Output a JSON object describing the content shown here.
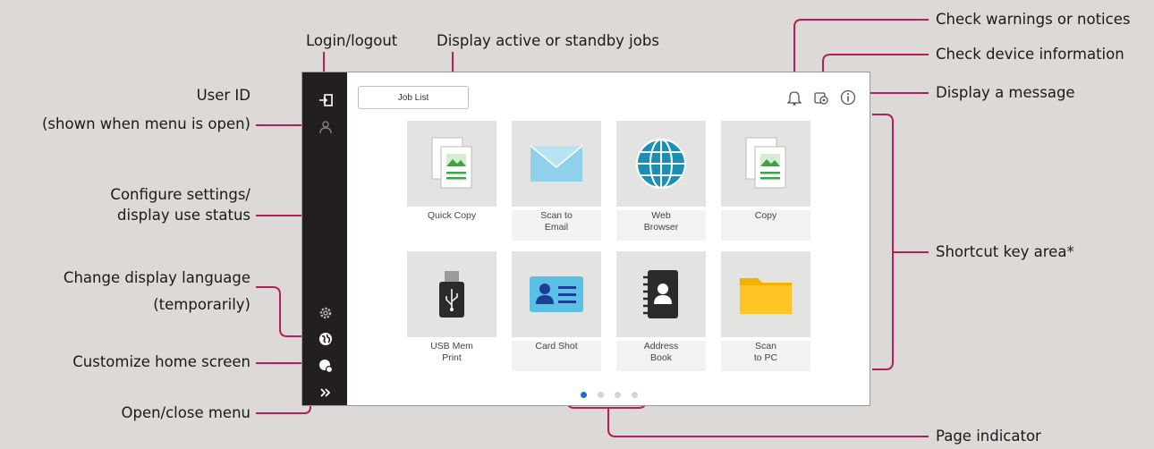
{
  "callouts": {
    "login_logout": "Login/logout",
    "active_jobs": "Display active or standby jobs",
    "user_id_1": "User ID",
    "user_id_2": "(shown when menu is open)",
    "configure_1": "Configure settings/",
    "configure_2": "display use status",
    "language_1": "Change display language",
    "language_2": "(temporarily)",
    "customize": "Customize home screen",
    "open_close": "Open/close menu",
    "warnings": "Check warnings or notices",
    "device_info": "Check device information",
    "message": "Display a message",
    "shortcut_area": "Shortcut key area*",
    "page_indicator": "Page indicator"
  },
  "screen": {
    "job_list_label": "Job List",
    "tiles": [
      {
        "line1": "Quick Copy",
        "line2": "",
        "icon": "copy-icon"
      },
      {
        "line1": "Scan to",
        "line2": "Email",
        "icon": "email-envelope-icon"
      },
      {
        "line1": "Web",
        "line2": "Browser",
        "icon": "globe-icon"
      },
      {
        "line1": "Copy",
        "line2": "",
        "icon": "copy-icon"
      },
      {
        "line1": "USB Mem",
        "line2": "Print",
        "icon": "usb-icon"
      },
      {
        "line1": "Card Shot",
        "line2": "",
        "icon": "id-card-icon"
      },
      {
        "line1": "Address",
        "line2": "Book",
        "icon": "address-book-icon"
      },
      {
        "line1": "Scan",
        "line2": "to PC",
        "icon": "folder-icon"
      }
    ],
    "page_count": 4,
    "current_page": 1
  },
  "colors": {
    "accent": "#b3205a",
    "sidebar": "#231f20",
    "active_dot": "#1f6fc0"
  }
}
